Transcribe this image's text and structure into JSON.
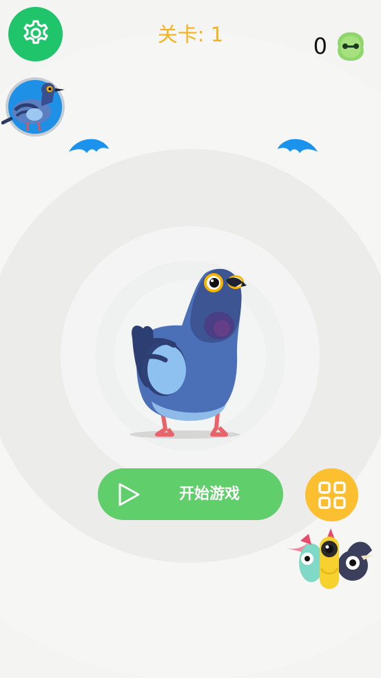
{
  "hud": {
    "level_label": "关卡: 1",
    "coin_count": "0",
    "settings_icon": "gear-icon",
    "coin_icon": "green-blob-coin-icon"
  },
  "main": {
    "start_button_label": "开始游戏",
    "play_icon": "play-icon",
    "collection_icon": "grid-icon"
  },
  "colors": {
    "background": "#f4f4f2",
    "settings_button": "#1fc46b",
    "level_text": "#f6b21a",
    "start_button": "#5fce6b",
    "grid_button": "#fbbf2f",
    "avatar_ring": "#1e90e5",
    "wing_blue": "#1b93ec"
  }
}
